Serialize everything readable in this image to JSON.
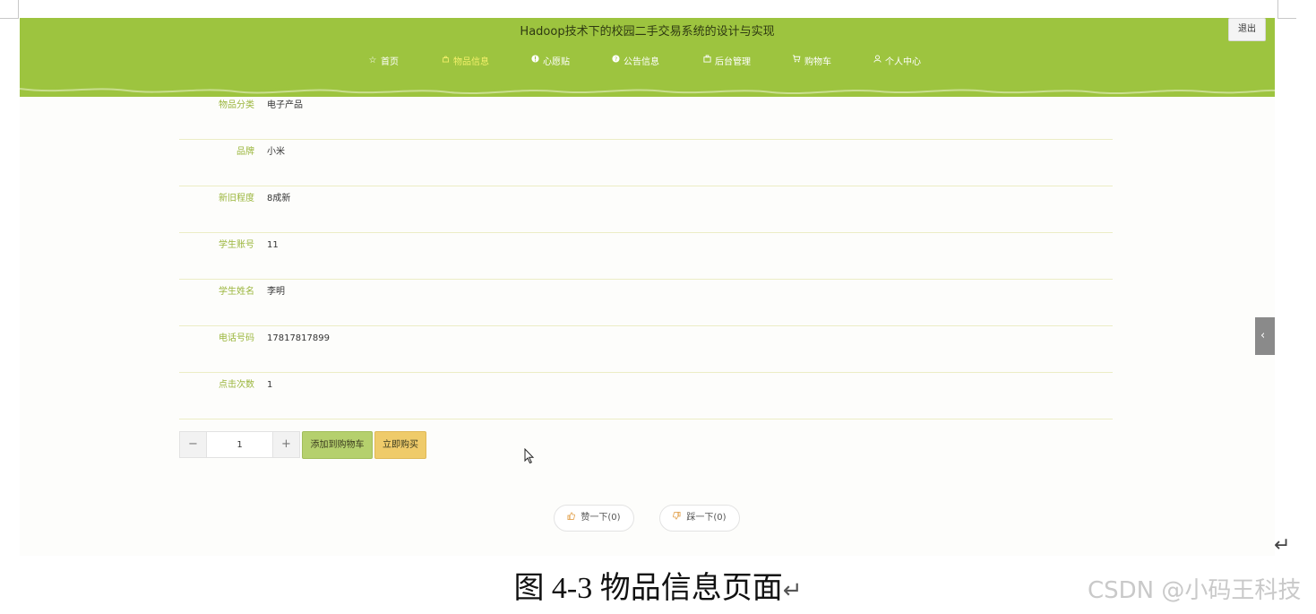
{
  "header": {
    "title": "Hadoop技术下的校园二手交易系统的设计与实现",
    "logout_label": "退出"
  },
  "nav": {
    "items": [
      {
        "label": "首页",
        "icon": "star-icon"
      },
      {
        "label": "物品信息",
        "icon": "bag-icon",
        "active": true
      },
      {
        "label": "心愿贴",
        "icon": "info-icon"
      },
      {
        "label": "公告信息",
        "icon": "help-icon"
      },
      {
        "label": "后台管理",
        "icon": "briefcase-icon"
      },
      {
        "label": "购物车",
        "icon": "cart-icon"
      },
      {
        "label": "个人中心",
        "icon": "user-icon"
      }
    ]
  },
  "details": [
    {
      "label": "物品分类",
      "value": "电子产品"
    },
    {
      "label": "品牌",
      "value": "小米"
    },
    {
      "label": "新旧程度",
      "value": "8成新"
    },
    {
      "label": "学生账号",
      "value": "11"
    },
    {
      "label": "学生姓名",
      "value": "李明"
    },
    {
      "label": "电话号码",
      "value": "17817817899"
    },
    {
      "label": "点击次数",
      "value": "1"
    }
  ],
  "purchase": {
    "quantity": "1",
    "minus_symbol": "−",
    "plus_symbol": "+",
    "add_to_cart_label": "添加到购物车",
    "buy_now_label": "立即购买"
  },
  "votes": {
    "like_label": "赞一下(0)",
    "dislike_label": "踩一下(0)"
  },
  "side_toggle_symbol": "‹",
  "caption": {
    "text": "图 4-3 物品信息页面",
    "return_symbol": "↵"
  },
  "page_return_symbol": "↵",
  "watermark": "CSDN @小码王科技",
  "colors": {
    "header_green": "#9dc43f",
    "label_green": "#9bb63d",
    "active_nav": "#f3f06a",
    "add_cart_bg": "#b5d06d",
    "buy_now_bg": "#efcb6a"
  }
}
